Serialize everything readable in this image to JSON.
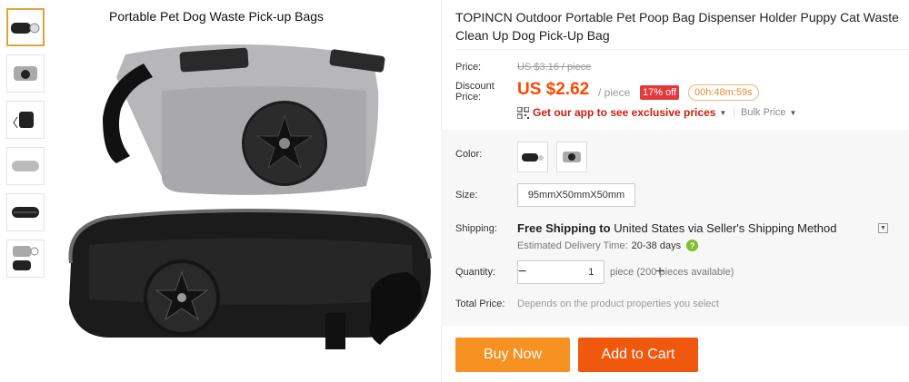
{
  "image": {
    "caption": "Portable Pet Dog Waste Pick-up Bags"
  },
  "thumbnails": [
    "black-bag-with-roll",
    "grey-bag-front",
    "black-bag-side",
    "grey-bag-side",
    "black-bag-open",
    "bags-with-clips"
  ],
  "product": {
    "title": "TOPINCN Outdoor Portable Pet Poop Bag Dispenser Holder Puppy Cat Waste Clean Up Dog Pick-Up Bag"
  },
  "price": {
    "label": "Price:",
    "original": "US $3.16 / piece",
    "discount_label": "Discount Price:",
    "discount_value": "US $2.62",
    "per_piece": "/ piece",
    "off_badge": "17% off",
    "countdown": "00h:48m:59s"
  },
  "promo": {
    "app_link": "Get our app to see exclusive prices",
    "bulk_price": "Bulk Price"
  },
  "options": {
    "color_label": "Color:",
    "size_label": "Size:",
    "size_value": "95mmX50mmX50mm",
    "shipping_label": "Shipping:",
    "shipping_prefix": "Free Shipping to",
    "shipping_dest": "United States via Seller's Shipping Method",
    "delivery_label": "Estimated Delivery Time:",
    "delivery_value": "20-38 days",
    "quantity_label": "Quantity:",
    "quantity_value": "1",
    "quantity_available": "piece (200 pieces available)",
    "total_label": "Total Price:",
    "total_note": "Depends on the product properties you select"
  },
  "actions": {
    "buy_now": "Buy Now",
    "add_to_cart": "Add to Cart"
  },
  "colors": {
    "accent_orange": "#f79122",
    "cart_orange": "#f0580e",
    "price_red": "#ff4800",
    "badge_red": "#e4393c",
    "app_red": "#c8210f"
  }
}
